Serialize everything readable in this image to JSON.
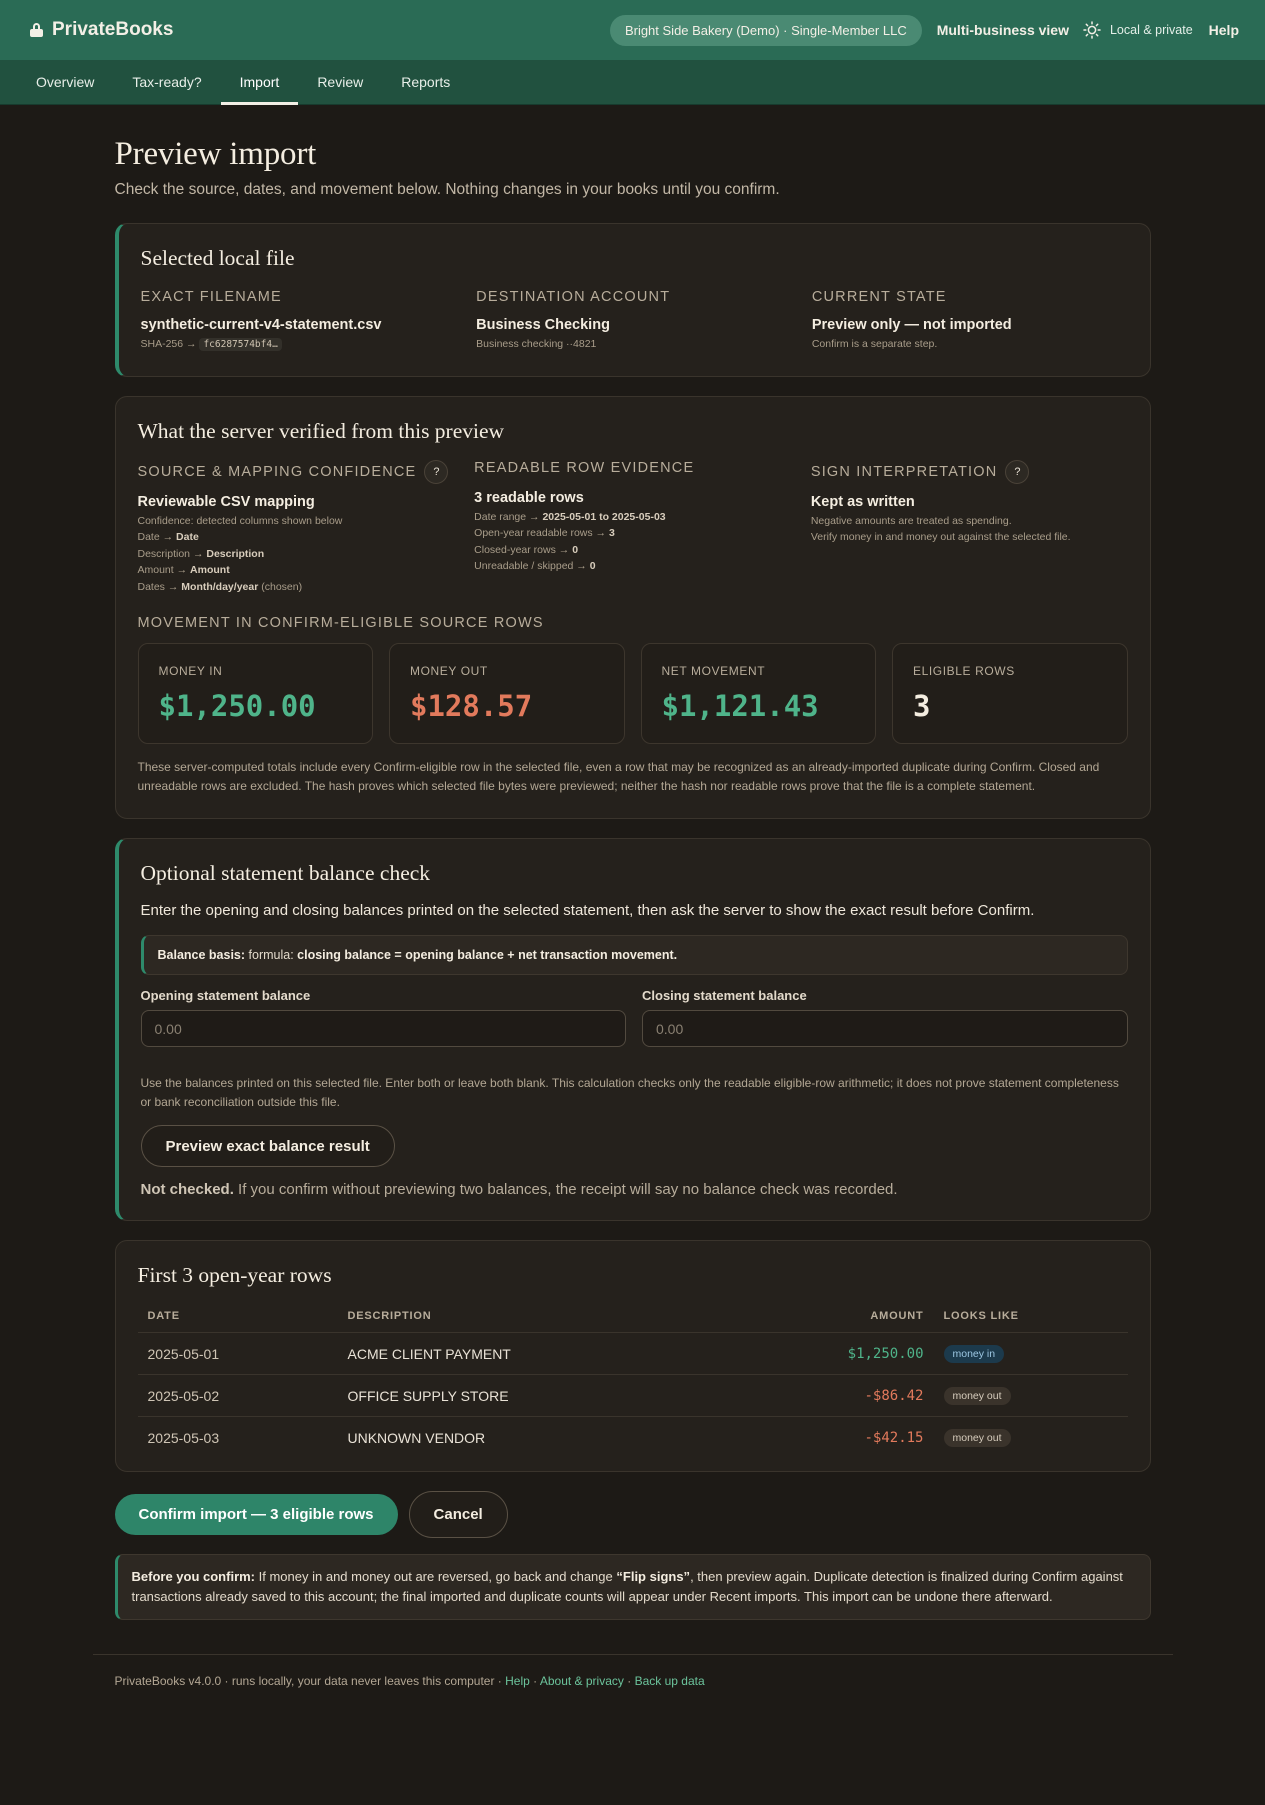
{
  "header": {
    "brand": "PrivateBooks",
    "business": "Bright Side Bakery (Demo) · Single-Member LLC",
    "multi_business": "Multi-business view",
    "local_private": "Local & private",
    "help": "Help"
  },
  "nav": {
    "tabs": [
      {
        "label": "Overview",
        "active": false
      },
      {
        "label": "Tax-ready?",
        "active": false
      },
      {
        "label": "Import",
        "active": true
      },
      {
        "label": "Review",
        "active": false
      },
      {
        "label": "Reports",
        "active": false
      }
    ]
  },
  "page": {
    "title": "Preview import",
    "subtitle": "Check the source, dates, and movement below. Nothing changes in your books until you confirm."
  },
  "selected_file": {
    "title": "Selected local file",
    "filename_label": "EXACT FILENAME",
    "filename": "synthetic-current-v4-statement.csv",
    "hash_prefix": "SHA-256 →",
    "hash": "fc6287574bf4…",
    "account_label": "DESTINATION ACCOUNT",
    "account": "Business Checking",
    "account_detail": "Business checking ··4821",
    "state_label": "CURRENT STATE",
    "state": "Preview only — not imported",
    "state_detail": "Confirm is a separate step."
  },
  "verified": {
    "title": "What the server verified from this preview",
    "mapping_label": "SOURCE & MAPPING CONFIDENCE",
    "mapping_value": "Reviewable CSV mapping",
    "mapping_confidence": "Confidence: detected columns shown below",
    "map_date_prefix": "Date →",
    "map_date": "Date",
    "map_desc_prefix": "Description →",
    "map_desc": "Description",
    "map_amount_prefix": "Amount →",
    "map_amount": "Amount",
    "map_dates_prefix": "Dates →",
    "map_dates": "Month/day/year",
    "map_dates_suffix": "(chosen)",
    "rows_label": "READABLE ROW EVIDENCE",
    "rows_value": "3 readable rows",
    "date_range_prefix": "Date range →",
    "date_range": "2025-05-01 to 2025-05-03",
    "open_year_prefix": "Open-year readable rows →",
    "open_year": "3",
    "closed_year_prefix": "Closed-year rows →",
    "closed_year": "0",
    "unreadable_prefix": "Unreadable / skipped →",
    "unreadable": "0",
    "sign_label": "SIGN INTERPRETATION",
    "sign_value": "Kept as written",
    "sign_line1": "Negative amounts are treated as spending.",
    "sign_line2": "Verify money in and money out against the selected file.",
    "help_q": "?",
    "movement_label": "MOVEMENT IN CONFIRM-ELIGIBLE SOURCE ROWS",
    "metrics": [
      {
        "label": "MONEY IN",
        "value": "$1,250.00",
        "color": "#4fb48a"
      },
      {
        "label": "MONEY OUT",
        "value": "$128.57",
        "color": "#e27a5c"
      },
      {
        "label": "NET MOVEMENT",
        "value": "$1,121.43",
        "color": "#4fb48a"
      },
      {
        "label": "ELIGIBLE ROWS",
        "value": "3",
        "color": "#f4ede0"
      }
    ],
    "note": "These server-computed totals include every Confirm-eligible row in the selected file, even a row that may be recognized as an already-imported duplicate during Confirm. Closed and unreadable rows are excluded. The hash proves which selected file bytes were previewed; neither the hash nor readable rows prove that the file is a complete statement."
  },
  "balance": {
    "title": "Optional statement balance check",
    "intro": "Enter the opening and closing balances printed on the selected statement, then ask the server to show the exact result before Confirm.",
    "basis_label": "Balance basis:",
    "basis_prefix": "formula:",
    "basis_formula": "closing balance = opening balance + net transaction movement.",
    "opening_label": "Opening statement balance",
    "opening_placeholder": "0.00",
    "closing_label": "Closing statement balance",
    "closing_placeholder": "0.00",
    "help_text": "Use the balances printed on this selected file. Enter both or leave both blank. This calculation checks only the readable eligible-row arithmetic; it does not prove statement completeness or bank reconciliation outside this file.",
    "preview_button": "Preview exact balance result",
    "status_bold": "Not checked.",
    "status_text": "If you confirm without previewing two balances, the receipt will say no balance check was recorded."
  },
  "rows_table": {
    "title": "First 3 open-year rows",
    "headers": {
      "date": "DATE",
      "description": "DESCRIPTION",
      "amount": "AMOUNT",
      "looks_like": "LOOKS LIKE"
    },
    "rows": [
      {
        "date": "2025-05-01",
        "description": "ACME CLIENT PAYMENT",
        "amount": "$1,250.00",
        "type": "money in"
      },
      {
        "date": "2025-05-02",
        "description": "OFFICE SUPPLY STORE",
        "amount": "-$86.42",
        "type": "money out"
      },
      {
        "date": "2025-05-03",
        "description": "UNKNOWN VENDOR",
        "amount": "-$42.15",
        "type": "money out"
      }
    ]
  },
  "actions": {
    "confirm": "Confirm import — 3 eligible rows",
    "cancel": "Cancel"
  },
  "warning": {
    "bold": "Before you confirm:",
    "text1": "If money in and money out are reversed, go back and change",
    "flip": "“Flip signs”",
    "text2": ", then preview again. Duplicate detection is finalized during Confirm against transactions already saved to this account; the final imported and duplicate counts will appear under Recent imports. This import can be undone there afterward."
  },
  "footer": {
    "text": "PrivateBooks v4.0.0 · runs locally, your data never leaves this computer ·",
    "help": "Help",
    "about": "About & privacy",
    "backup": "Back up data",
    "sep": "·"
  }
}
